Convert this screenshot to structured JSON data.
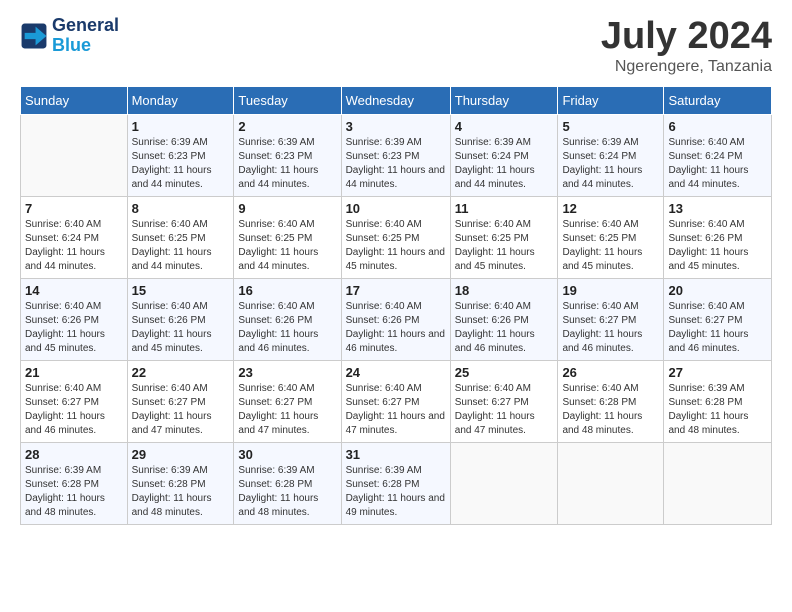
{
  "header": {
    "logo_line1": "General",
    "logo_line2": "Blue",
    "month": "July 2024",
    "location": "Ngerengere, Tanzania"
  },
  "weekdays": [
    "Sunday",
    "Monday",
    "Tuesday",
    "Wednesday",
    "Thursday",
    "Friday",
    "Saturday"
  ],
  "weeks": [
    [
      {
        "day": "",
        "info": ""
      },
      {
        "day": "1",
        "info": "Sunrise: 6:39 AM\nSunset: 6:23 PM\nDaylight: 11 hours and 44 minutes."
      },
      {
        "day": "2",
        "info": "Sunrise: 6:39 AM\nSunset: 6:23 PM\nDaylight: 11 hours and 44 minutes."
      },
      {
        "day": "3",
        "info": "Sunrise: 6:39 AM\nSunset: 6:23 PM\nDaylight: 11 hours and 44 minutes."
      },
      {
        "day": "4",
        "info": "Sunrise: 6:39 AM\nSunset: 6:24 PM\nDaylight: 11 hours and 44 minutes."
      },
      {
        "day": "5",
        "info": "Sunrise: 6:39 AM\nSunset: 6:24 PM\nDaylight: 11 hours and 44 minutes."
      },
      {
        "day": "6",
        "info": "Sunrise: 6:40 AM\nSunset: 6:24 PM\nDaylight: 11 hours and 44 minutes."
      }
    ],
    [
      {
        "day": "7",
        "info": "Sunrise: 6:40 AM\nSunset: 6:24 PM\nDaylight: 11 hours and 44 minutes."
      },
      {
        "day": "8",
        "info": "Sunrise: 6:40 AM\nSunset: 6:25 PM\nDaylight: 11 hours and 44 minutes."
      },
      {
        "day": "9",
        "info": "Sunrise: 6:40 AM\nSunset: 6:25 PM\nDaylight: 11 hours and 44 minutes."
      },
      {
        "day": "10",
        "info": "Sunrise: 6:40 AM\nSunset: 6:25 PM\nDaylight: 11 hours and 45 minutes."
      },
      {
        "day": "11",
        "info": "Sunrise: 6:40 AM\nSunset: 6:25 PM\nDaylight: 11 hours and 45 minutes."
      },
      {
        "day": "12",
        "info": "Sunrise: 6:40 AM\nSunset: 6:25 PM\nDaylight: 11 hours and 45 minutes."
      },
      {
        "day": "13",
        "info": "Sunrise: 6:40 AM\nSunset: 6:26 PM\nDaylight: 11 hours and 45 minutes."
      }
    ],
    [
      {
        "day": "14",
        "info": "Sunrise: 6:40 AM\nSunset: 6:26 PM\nDaylight: 11 hours and 45 minutes."
      },
      {
        "day": "15",
        "info": "Sunrise: 6:40 AM\nSunset: 6:26 PM\nDaylight: 11 hours and 45 minutes."
      },
      {
        "day": "16",
        "info": "Sunrise: 6:40 AM\nSunset: 6:26 PM\nDaylight: 11 hours and 46 minutes."
      },
      {
        "day": "17",
        "info": "Sunrise: 6:40 AM\nSunset: 6:26 PM\nDaylight: 11 hours and 46 minutes."
      },
      {
        "day": "18",
        "info": "Sunrise: 6:40 AM\nSunset: 6:26 PM\nDaylight: 11 hours and 46 minutes."
      },
      {
        "day": "19",
        "info": "Sunrise: 6:40 AM\nSunset: 6:27 PM\nDaylight: 11 hours and 46 minutes."
      },
      {
        "day": "20",
        "info": "Sunrise: 6:40 AM\nSunset: 6:27 PM\nDaylight: 11 hours and 46 minutes."
      }
    ],
    [
      {
        "day": "21",
        "info": "Sunrise: 6:40 AM\nSunset: 6:27 PM\nDaylight: 11 hours and 46 minutes."
      },
      {
        "day": "22",
        "info": "Sunrise: 6:40 AM\nSunset: 6:27 PM\nDaylight: 11 hours and 47 minutes."
      },
      {
        "day": "23",
        "info": "Sunrise: 6:40 AM\nSunset: 6:27 PM\nDaylight: 11 hours and 47 minutes."
      },
      {
        "day": "24",
        "info": "Sunrise: 6:40 AM\nSunset: 6:27 PM\nDaylight: 11 hours and 47 minutes."
      },
      {
        "day": "25",
        "info": "Sunrise: 6:40 AM\nSunset: 6:27 PM\nDaylight: 11 hours and 47 minutes."
      },
      {
        "day": "26",
        "info": "Sunrise: 6:40 AM\nSunset: 6:28 PM\nDaylight: 11 hours and 48 minutes."
      },
      {
        "day": "27",
        "info": "Sunrise: 6:39 AM\nSunset: 6:28 PM\nDaylight: 11 hours and 48 minutes."
      }
    ],
    [
      {
        "day": "28",
        "info": "Sunrise: 6:39 AM\nSunset: 6:28 PM\nDaylight: 11 hours and 48 minutes."
      },
      {
        "day": "29",
        "info": "Sunrise: 6:39 AM\nSunset: 6:28 PM\nDaylight: 11 hours and 48 minutes."
      },
      {
        "day": "30",
        "info": "Sunrise: 6:39 AM\nSunset: 6:28 PM\nDaylight: 11 hours and 48 minutes."
      },
      {
        "day": "31",
        "info": "Sunrise: 6:39 AM\nSunset: 6:28 PM\nDaylight: 11 hours and 49 minutes."
      },
      {
        "day": "",
        "info": ""
      },
      {
        "day": "",
        "info": ""
      },
      {
        "day": "",
        "info": ""
      }
    ]
  ]
}
